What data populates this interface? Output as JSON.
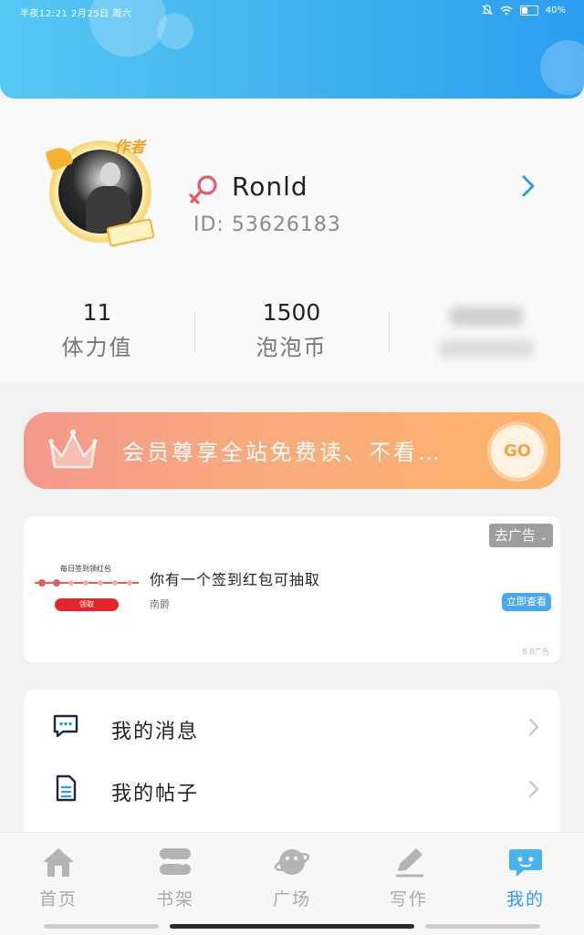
{
  "status_bar": {
    "time_text": "半夜12:21  2月25日 周六",
    "battery_text": "40%",
    "battery_level": 0.4,
    "icons": [
      "mute-icon",
      "wifi-icon",
      "battery-icon"
    ]
  },
  "profile": {
    "author_tag": "作者",
    "gender_icon": "female-symbol-icon",
    "username": "Ronld",
    "user_id": "ID: 53626183",
    "stats": [
      {
        "value": "11",
        "label": "体力值"
      },
      {
        "value": "1500",
        "label": "泡泡币"
      },
      {
        "value": "",
        "label": "",
        "blurred": true
      }
    ]
  },
  "vip_banner": {
    "text": "会员尊享全站免费读、不看…",
    "button_label": "GO"
  },
  "ad": {
    "remove_label": "去广告",
    "thumb_title": "每日签到领红包",
    "thumb_button": "领取",
    "title": "你有一个签到红包可抽取",
    "source": "南爵",
    "cta_label": "立即查看",
    "footer": "B B广告"
  },
  "menu": {
    "items": [
      {
        "label": "我的消息",
        "icon": "message-icon"
      },
      {
        "label": "我的帖子",
        "icon": "document-icon"
      }
    ]
  },
  "tabbar": {
    "tabs": [
      {
        "label": "首页",
        "icon": "home-icon"
      },
      {
        "label": "书架",
        "icon": "bookshelf-icon"
      },
      {
        "label": "广场",
        "icon": "planet-icon"
      },
      {
        "label": "写作",
        "icon": "pen-icon"
      },
      {
        "label": "我的",
        "icon": "chat-bubble-icon",
        "active": true
      }
    ]
  },
  "colors": {
    "accent": "#2f9bf0",
    "header_gradient": [
      "#56c8f4",
      "#2c9ef0"
    ],
    "vip_gradient": [
      "#f6988c",
      "#fbb46a"
    ],
    "female_icon": "#e85a6b"
  }
}
